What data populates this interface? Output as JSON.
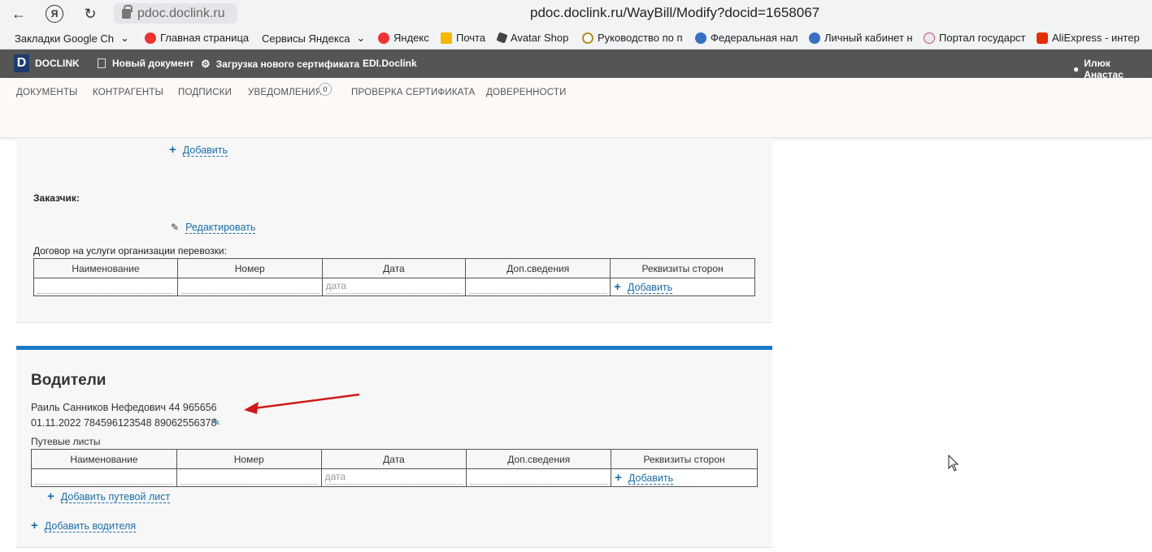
{
  "browser": {
    "domain": "pdoc.doclink.ru",
    "url": "pdoc.doclink.ru/WayBill/Modify?docid=1658067",
    "bookmarks": [
      "Закладки Google Ch",
      "Главная страница",
      "Сервисы Яндекса",
      "Яндекс",
      "Почта",
      "Avatar Shop",
      "Руководство по п",
      "Федеральная нал",
      "Личный кабинет н",
      "Портал государст",
      "AliExpress - интер"
    ]
  },
  "app": {
    "logo_letter": "D",
    "brand": "DOCLINK",
    "new_doc": "Новый документ",
    "upload_cert": "Загрузка нового сертификата",
    "edi": "EDI.Doclink",
    "user": "Илюк Анастас"
  },
  "menu": {
    "documents": "ДОКУМЕНТЫ",
    "contractors": "КОНТРАГЕНТЫ",
    "subscriptions": "ПОДПИСКИ",
    "notifications": "УВЕДОМЛЕНИЯ",
    "notifications_count": "0",
    "cert_check": "ПРОВЕРКА СЕРТИФИКАТА",
    "trust": "ДОВЕРЕННОСТИ"
  },
  "customer_section": {
    "add_link": "Добавить",
    "customer_label": "Заказчик:",
    "edit_link": "Редактировать",
    "contract_label": "Договор на услуги организации перевозки:",
    "table_headers": [
      "Наименование",
      "Номер",
      "Дата",
      "Доп.сведения",
      "Реквизиты сторон"
    ],
    "date_placeholder": "дата",
    "add_row": "Добавить"
  },
  "drivers_section": {
    "title": "Водители",
    "driver_line1": "Раиль Санников Нефедович 44 965656",
    "driver_line2": "01.11.2022 784596123548 89062556378",
    "waybills_label": "Путевые листы",
    "table_headers": [
      "Наименование",
      "Номер",
      "Дата",
      "Доп.сведения",
      "Реквизиты сторон"
    ],
    "date_placeholder": "дата",
    "add_row": "Добавить",
    "add_waybill": "Добавить путевой лист",
    "add_driver": "Добавить водителя"
  },
  "colors": {
    "accent_blue": "#1a7bc9",
    "link_blue": "#1a6ea8",
    "header_bg": "#555555",
    "arrow_red": "#d01a1a"
  }
}
